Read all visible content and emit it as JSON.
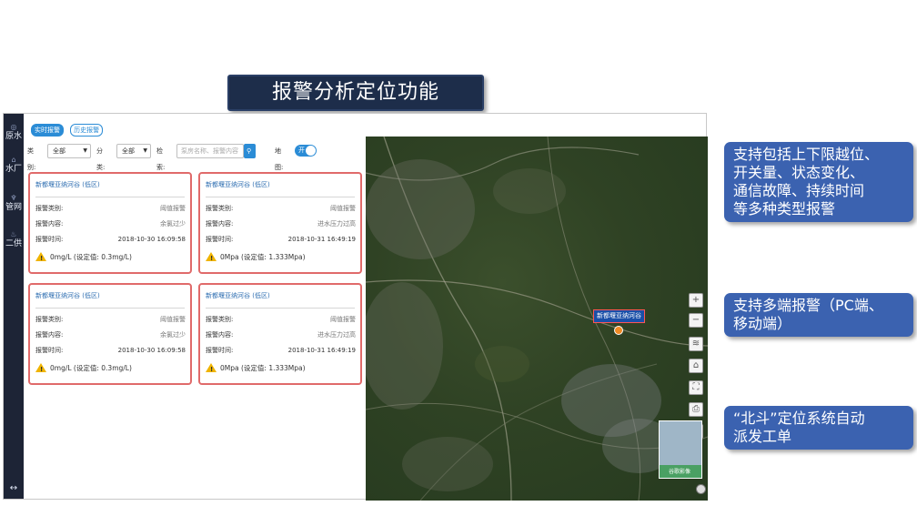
{
  "slide_title": "报警分析定位功能",
  "sidebar": {
    "items": [
      {
        "label": "原水",
        "icon": "water-source-icon"
      },
      {
        "label": "水厂",
        "icon": "plant-icon"
      },
      {
        "label": "管网",
        "icon": "pipe-icon"
      },
      {
        "label": "二供",
        "icon": "supply-icon"
      }
    ],
    "expand_icon": "↔"
  },
  "tabs": [
    {
      "label": "实时报警",
      "active": true
    },
    {
      "label": "历史报警",
      "active": false
    }
  ],
  "filters": {
    "type_label": "类别:",
    "type_value": "全部",
    "category_label": "分类:",
    "category_value": "全部",
    "search_label": "检索:",
    "search_placeholder": "泵房名称、报警内容",
    "search_button": "查询",
    "map_label": "地图:",
    "map_toggle": "开"
  },
  "labels": {
    "alarm_type": "报警类别:",
    "alarm_content": "报警内容:",
    "alarm_time": "报警时间:"
  },
  "cards": [
    {
      "name": "新都堰亚纳河谷 (低区)",
      "type": "阈值报警",
      "content": "余氯过少",
      "time": "2018-10-30 16:09:58",
      "value": "0mg/L (设定值: 0.3mg/L)"
    },
    {
      "name": "新都堰亚纳河谷 (低区)",
      "type": "阈值报警",
      "content": "进水压力过高",
      "time": "2018-10-31 16:49:19",
      "value": "0Mpa (设定值: 1.333Mpa)"
    },
    {
      "name": "新都堰亚纳河谷 (低区)",
      "type": "阈值报警",
      "content": "余氯过少",
      "time": "2018-10-30 16:09:58",
      "value": "0mg/L (设定值: 0.3mg/L)"
    },
    {
      "name": "新都堰亚纳河谷 (低区)",
      "type": "阈值报警",
      "content": "进水压力过高",
      "time": "2018-10-31 16:49:19",
      "value": "0Mpa (设定值: 1.333Mpa)"
    }
  ],
  "map": {
    "marker_label": "新都堰亚纳河谷",
    "controls": [
      "+",
      "−",
      "≋",
      "⌂",
      "⛶",
      "⎙",
      "⌕"
    ],
    "minimap_label": "谷歌影像"
  },
  "callouts": [
    [
      "支持包括上下限越位、",
      "开关量、状态变化、",
      "通信故障、持续时间",
      "等多种类型报警"
    ],
    [
      "支持多端报警（PC端、",
      "移动端）"
    ],
    [
      "“北斗”定位系统自动",
      "派发工单"
    ]
  ]
}
